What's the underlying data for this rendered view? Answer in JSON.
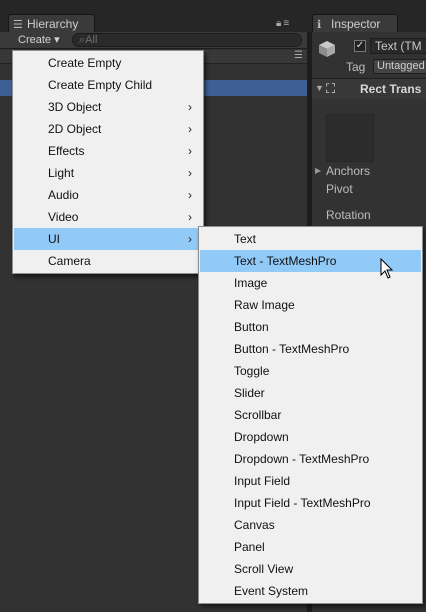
{
  "tabs": {
    "hierarchy": {
      "label": "Hierarchy",
      "icon": "list-icon"
    },
    "inspector": {
      "label": "Inspector",
      "icon": "info-icon"
    }
  },
  "hierarchy": {
    "create_label": "Create ▾",
    "search_placeholder": "All"
  },
  "inspector": {
    "object_name": "Text (TM",
    "tag_label": "Tag",
    "tag_value": "Untagged",
    "component_title": "Rect Trans",
    "anchors_label": "Anchors",
    "pivot_label": "Pivot",
    "rotation_label": "Rotation"
  },
  "create_menu": {
    "items": [
      {
        "label": "Create Empty",
        "submenu": false
      },
      {
        "label": "Create Empty Child",
        "submenu": false
      },
      {
        "label": "3D Object",
        "submenu": true
      },
      {
        "label": "2D Object",
        "submenu": true
      },
      {
        "label": "Effects",
        "submenu": true
      },
      {
        "label": "Light",
        "submenu": true
      },
      {
        "label": "Audio",
        "submenu": true
      },
      {
        "label": "Video",
        "submenu": true
      },
      {
        "label": "UI",
        "submenu": true,
        "highlighted": true
      },
      {
        "label": "Camera",
        "submenu": false
      }
    ],
    "arrow": "›"
  },
  "ui_submenu": {
    "items": [
      {
        "label": "Text"
      },
      {
        "label": "Text - TextMeshPro",
        "highlighted": true
      },
      {
        "label": "Image"
      },
      {
        "label": "Raw Image"
      },
      {
        "label": "Button"
      },
      {
        "label": "Button - TextMeshPro"
      },
      {
        "label": "Toggle"
      },
      {
        "label": "Slider"
      },
      {
        "label": "Scrollbar"
      },
      {
        "label": "Dropdown"
      },
      {
        "label": "Dropdown - TextMeshPro"
      },
      {
        "label": "Input Field"
      },
      {
        "label": "Input Field - TextMeshPro"
      },
      {
        "label": "Canvas"
      },
      {
        "label": "Panel"
      },
      {
        "label": "Scroll View"
      },
      {
        "label": "Event System"
      }
    ]
  },
  "colors": {
    "menu_bg": "#f0f0f0",
    "menu_highlight": "#91c9f7",
    "selection_blue": "#3e5f96",
    "panel_bg": "#323232"
  }
}
